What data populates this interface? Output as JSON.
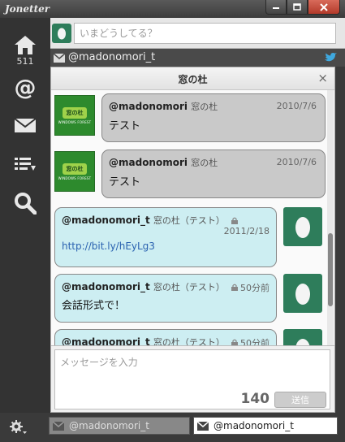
{
  "app": {
    "title": "Jonetter"
  },
  "window_buttons": {
    "minimize": "minimize",
    "maximize": "maximize",
    "close": "close"
  },
  "sidebar": {
    "home_count": "511",
    "icons": [
      "home-icon",
      "mention-icon",
      "mail-icon",
      "list-icon",
      "search-icon"
    ]
  },
  "status": {
    "placeholder": "いまどうしてる？"
  },
  "account": {
    "name": "@madonomori_t"
  },
  "conversation": {
    "title": "窓の杜",
    "close_glyph": "×",
    "messages": [
      {
        "name": "@madonomori",
        "sub": "窓の杜",
        "date": "2010/7/6",
        "text": "テスト",
        "side": "left",
        "color": "#c9c9c9"
      },
      {
        "name": "@madonomori",
        "sub": "窓の杜",
        "date": "2010/7/6",
        "text": "テスト",
        "side": "left",
        "color": "#c9c9c9"
      },
      {
        "name": "@madonomori_t",
        "sub": "窓の杜（テスト）",
        "date": "2011/2/18",
        "link": "http://bit.ly/hEyLg3",
        "side": "right",
        "color": "#cdeef2"
      },
      {
        "name": "@madonomori_t",
        "sub": "窓の杜（テスト）",
        "date": "50分前",
        "text": "会話形式で！",
        "side": "right",
        "color": "#cdeef2"
      },
      {
        "name": "@madonomori_t",
        "sub": "窓の杜（テスト）",
        "date": "50分前",
        "side": "right",
        "color": "#cdeef2"
      }
    ],
    "avatar_logo_text": "窓の杜",
    "avatar_logo_sub": "WINDOWS FOREST"
  },
  "compose": {
    "placeholder": "メッセージを入力",
    "count": "140",
    "send_label": "送信"
  },
  "bottom": {
    "tabs": [
      {
        "label": "@madonomori_t",
        "active": false
      },
      {
        "label": "@madonomori_t",
        "active": true
      }
    ]
  }
}
